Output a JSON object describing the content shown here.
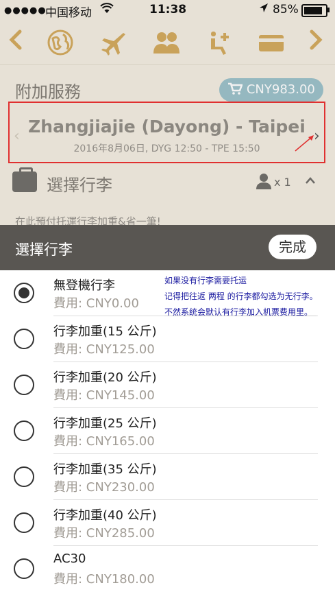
{
  "status_bar": {
    "dots": "●●●●●",
    "carrier": "中国移动",
    "time": "11:38",
    "battery": "85%"
  },
  "nav_icons": [
    "chevron-left-icon",
    "globe-icon",
    "plane-icon",
    "people-icon",
    "seat-icon",
    "card-icon",
    "chevron-right-icon"
  ],
  "section": {
    "title": "附加服務",
    "price": "CNY983.00"
  },
  "route": {
    "name": "Zhangjiajie (Dayong) - Taipei",
    "detail": "2016年8月06日, DYG 12:50 - TPE 15:50"
  },
  "baggage": {
    "title": "選擇行李",
    "pax_count": "x 1",
    "note": "在此預付托運行李加重&省一筆!"
  },
  "picker": {
    "title": "選擇行李",
    "done_label": "完成",
    "options": [
      {
        "name": "無登機行李",
        "fee": "費用: CNY0.00",
        "selected": true
      },
      {
        "name": "行李加重(15 公斤)",
        "fee": "費用: CNY125.00",
        "selected": false
      },
      {
        "name": "行李加重(20 公斤)",
        "fee": "費用: CNY145.00",
        "selected": false
      },
      {
        "name": "行李加重(25 公斤)",
        "fee": "費用: CNY165.00",
        "selected": false
      },
      {
        "name": "行李加重(35 公斤)",
        "fee": "費用: CNY230.00",
        "selected": false
      },
      {
        "name": "行李加重(40 公斤)",
        "fee": "費用: CNY285.00",
        "selected": false
      },
      {
        "name": "AC30",
        "fee": "費用: CNY180.00",
        "selected": false
      }
    ]
  },
  "annotation": {
    "line1": "如果没有行李需要托运",
    "line2": "记得把往返 两程 的行李都勾选为无行李。",
    "line3": "不然系统会默认有行李加入机票费用里。"
  },
  "colors": {
    "accent": "#c9a25a",
    "pill": "#95b8c0",
    "header": "#595652",
    "highlight_box": "#e03030",
    "annotation_text": "#1a1aa0"
  }
}
